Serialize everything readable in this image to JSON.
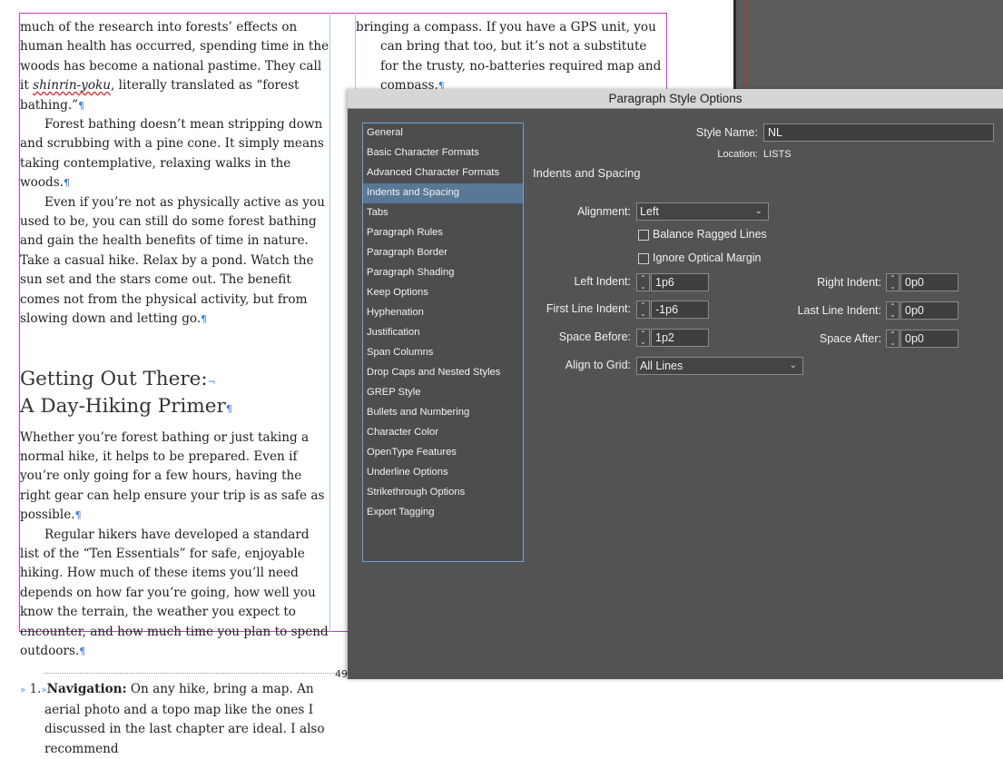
{
  "document": {
    "col1": {
      "p1_a": "much of the research into forests’ effects on human health has occurred, spending time in the woods has become a national pastime. They call it ",
      "p1_em": "shinrin-yoku",
      "p1_b": ", literally translated as “forest bathing.”",
      "p2": "Forest bathing doesn’t mean stripping down and scrubbing with a pine cone. It simply means taking contemplative, relaxing walks in the woods.",
      "p3": "Even if you’re not as physically active as you used to be, you can still do some forest bathing and gain the health benefits of time in nature. Take a casual hike. Relax by a pond. Watch the sun set and the stars come out. The benefit comes not from the physical activity, but from slowing down and letting go.",
      "heading_line1": "Getting Out There:",
      "heading_line2": "A Day-Hiking Primer",
      "p4": "Whether you’re forest bathing or just taking a normal hike, it helps to be prepared. Even if you’re only going for a few hours, having the right gear can help ensure your trip is as safe as possible.",
      "p5": "Regular hikers have developed a standard list of the “Ten Essentials” for safe, enjoyable hiking. How much of these items you’ll need depends on how far you’re going, how well you know the terrain, the weather you expect to encounter, and how much time you plan to spend outdoors.",
      "list_num": "1.",
      "list_bold": "Navigation:",
      "list_text": " On any hike, bring a map. An aerial photo and a topo map like the ones I discussed in the last chapter are ideal. I also recommend"
    },
    "col2": {
      "p1": "bringing a compass. If you have a GPS unit, you can bring that too, but it’s not a substitute for the trusty, no-batteries required map and compass."
    },
    "page_number": "49"
  },
  "dialog": {
    "title": "Paragraph Style Options",
    "style_name_label": "Style Name:",
    "style_name_value": "NL",
    "location_label": "Location:",
    "location_value": "LISTS",
    "section_title": "Indents and Spacing",
    "categories": [
      "General",
      "Basic Character Formats",
      "Advanced Character Formats",
      "Indents and Spacing",
      "Tabs",
      "Paragraph Rules",
      "Paragraph Border",
      "Paragraph Shading",
      "Keep Options",
      "Hyphenation",
      "Justification",
      "Span Columns",
      "Drop Caps and Nested Styles",
      "GREP Style",
      "Bullets and Numbering",
      "Character Color",
      "OpenType Features",
      "Underline Options",
      "Strikethrough Options",
      "Export Tagging"
    ],
    "selected_category": "Indents and Spacing",
    "alignment_label": "Alignment:",
    "alignment_value": "Left",
    "balance_ragged_label": "Balance Ragged Lines",
    "balance_ragged_checked": false,
    "ignore_optical_label": "Ignore Optical Margin",
    "ignore_optical_checked": false,
    "left_indent_label": "Left Indent:",
    "left_indent_value": "1p6",
    "right_indent_label": "Right Indent:",
    "right_indent_value": "0p0",
    "first_line_indent_label": "First Line Indent:",
    "first_line_indent_value": "-1p6",
    "last_line_indent_label": "Last Line Indent:",
    "last_line_indent_value": "0p0",
    "space_before_label": "Space Before:",
    "space_before_value": "1p2",
    "space_after_label": "Space After:",
    "space_after_value": "0p0",
    "align_grid_label": "Align to Grid:",
    "align_grid_value": "All Lines"
  }
}
